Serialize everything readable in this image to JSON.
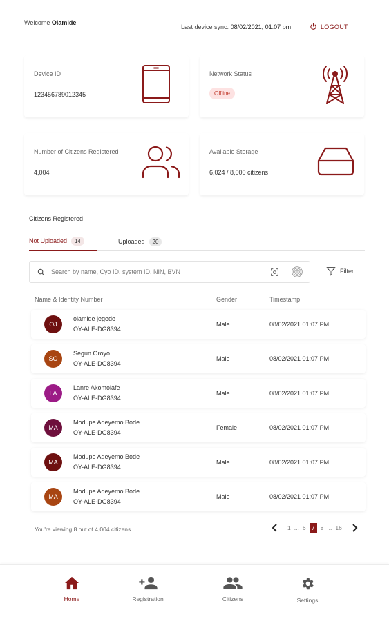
{
  "header": {
    "welcome_prefix": "Welcome",
    "welcome_name": "Olamide",
    "sync_prefix": "Last device sync:",
    "sync_value": "08/02/2021, 01:07 pm",
    "logout_label": "LOGOUT"
  },
  "cards": {
    "device_id": {
      "label": "Device ID",
      "value": "123456789012345",
      "icon": "tablet-icon"
    },
    "network_status": {
      "label": "Network Status",
      "value": "Offline",
      "icon": "antenna-tower-icon"
    },
    "citizens_registered": {
      "label": "Number of Citizens Registered",
      "value": "4,004",
      "icon": "users-icon"
    },
    "available_storage": {
      "label": "Available Storage",
      "value": "6,024 / 8,000 citizens",
      "icon": "storage-drive-icon"
    }
  },
  "section_title": "Citizens Registered",
  "tabs": [
    {
      "label": "Not Uploaded",
      "count": "14",
      "active": true
    },
    {
      "label": "Uploaded",
      "count": "20",
      "active": false
    }
  ],
  "search": {
    "placeholder": "Search by name, Cyo ID, system ID, NIN, BVN"
  },
  "filter_label": "Filter",
  "table": {
    "headers": {
      "name": "Name & Identity Number",
      "gender": "Gender",
      "timestamp": "Timestamp"
    },
    "rows": [
      {
        "initials": "OJ",
        "name": "olamide jegede",
        "id": "OY-ALE-DG8394",
        "gender": "Male",
        "timestamp": "08/02/2021 01:07 PM",
        "color": "#6e1010"
      },
      {
        "initials": "SO",
        "name": "Segun Oroyo",
        "id": "OY-ALE-DG8394",
        "gender": "Male",
        "timestamp": "08/02/2021 01:07 PM",
        "color": "#a84512"
      },
      {
        "initials": "LA",
        "name": "Lanre Akomolafe",
        "id": "OY-ALE-DG8394",
        "gender": "Male",
        "timestamp": "08/02/2021 01:07 PM",
        "color": "#9c1b86"
      },
      {
        "initials": "MA",
        "name": "Modupe Adeyemo Bode",
        "id": "OY-ALE-DG8394",
        "gender": "Female",
        "timestamp": "08/02/2021 01:07 PM",
        "color": "#6e0f3c"
      },
      {
        "initials": "MA",
        "name": "Modupe Adeyemo Bode",
        "id": "OY-ALE-DG8394",
        "gender": "Male",
        "timestamp": "08/02/2021 01:07 PM",
        "color": "#6e1010"
      },
      {
        "initials": "MA",
        "name": "Modupe Adeyemo Bode",
        "id": "OY-ALE-DG8394",
        "gender": "Male",
        "timestamp": "08/02/2021 01:07 PM",
        "color": "#a84512"
      }
    ]
  },
  "footer": {
    "viewing_text": "You're viewing 8 out of 4,004 citizens",
    "pages": [
      "1",
      "...",
      "6",
      "7",
      "8",
      "...",
      "16"
    ],
    "current_page": "7"
  },
  "bottom_nav": [
    {
      "label": "Home",
      "icon": "home-icon",
      "active": true
    },
    {
      "label": "Registration",
      "icon": "add-person-icon",
      "active": false
    },
    {
      "label": "Citizens",
      "icon": "people-icon",
      "active": false
    },
    {
      "label": "Settings",
      "icon": "gear-icon",
      "active": false
    }
  ],
  "colors": {
    "accent": "#8b1a1a",
    "offline_bg": "#fde2e2",
    "offline_text": "#c0392b"
  }
}
